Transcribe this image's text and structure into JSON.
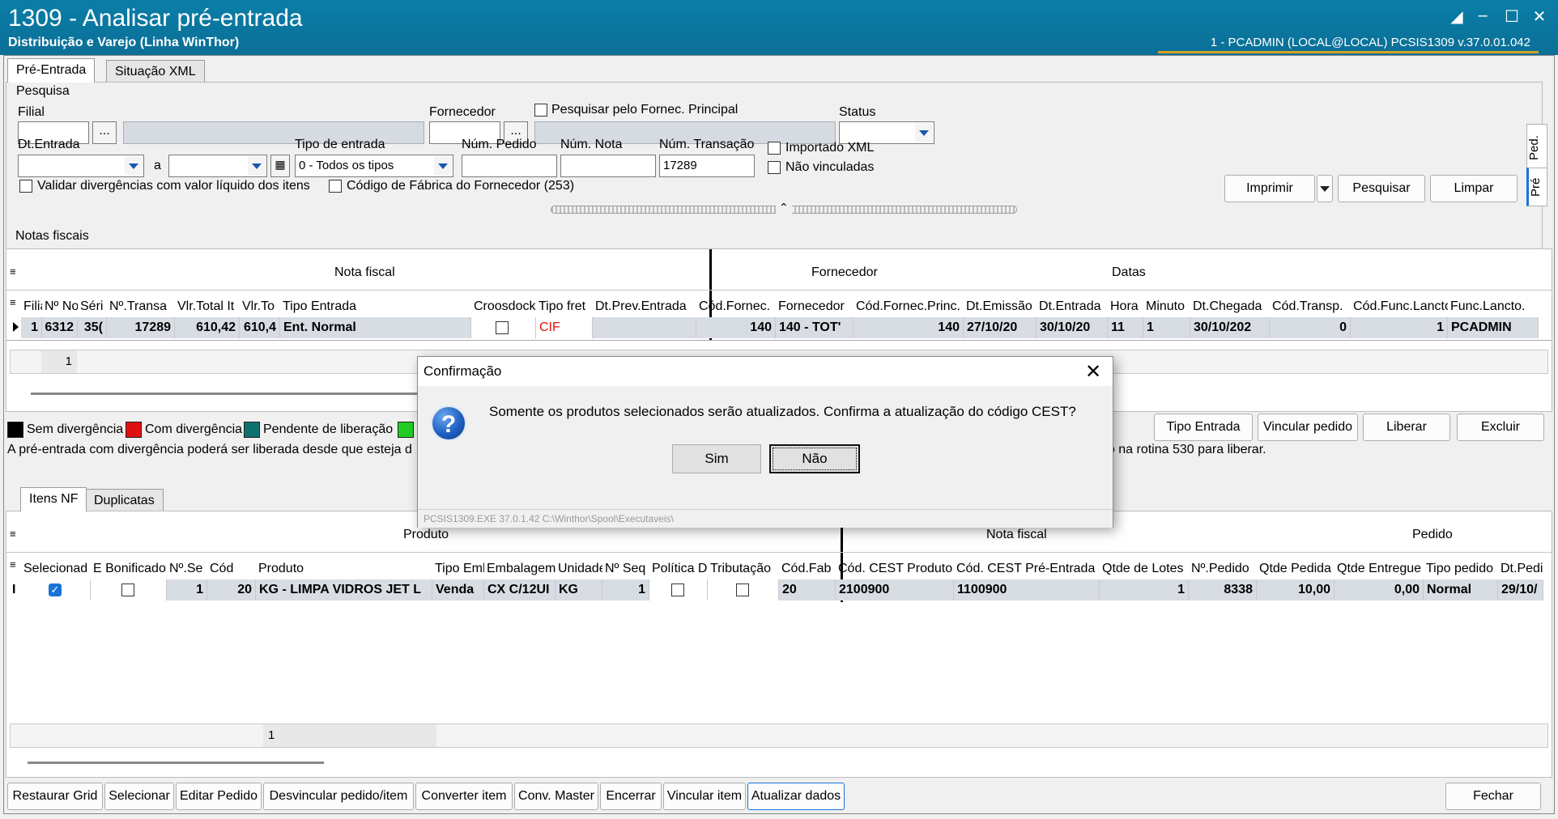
{
  "window": {
    "title": "1309 - Analisar pré-entrada",
    "subtitle": "Distribuição e Varejo (Linha WinThor)",
    "info": "1 - PCADMIN (LOCAL@LOCAL)   PCSIS1309  v.37.0.01.042"
  },
  "top_tabs": [
    "Pré-Entrada",
    "Situação XML"
  ],
  "search": {
    "group_label": "Pesquisa",
    "filial_label": "Filial",
    "fornecedor_label": "Fornecedor",
    "pesquisar_principal_label": "Pesquisar pelo Fornec. Principal",
    "status_label": "Status",
    "dt_entrada_label": "Dt.Entrada",
    "a_label": "a",
    "tipo_entrada_label": "Tipo de entrada",
    "tipo_entrada_value": "0 - Todos os tipos",
    "num_pedido_label": "Núm. Pedido",
    "num_nota_label": "Núm. Nota",
    "num_transacao_label": "Núm. Transação",
    "num_transacao_value": "17289",
    "importado_xml_label": "Importado XML",
    "nao_vinculadas_label": "Não vinculadas",
    "validar_label": "Validar divergências com valor líquido dos itens",
    "codigo_fabrica_label": "Código de Fábrica do Fornecedor (253)",
    "ellipsis": "...",
    "imprimir": "Imprimir",
    "pesquisar": "Pesquisar",
    "limpar": "Limpar"
  },
  "side_tabs": [
    "Ped.",
    "Pré"
  ],
  "notas": {
    "group_label": "Notas fiscais",
    "band_nota_fiscal": "Nota fiscal",
    "band_fornecedor": "Fornecedor",
    "band_datas": "Datas",
    "columns": [
      "Filia",
      "Nº No",
      "Séri",
      "Nº.Transa",
      "Vlr.Total It",
      "Vlr.To",
      "Tipo Entrada",
      "Croosdock",
      "Tipo fret",
      "Dt.Prev.Entrada",
      "Cód.Fornec.",
      "Fornecedor",
      "Cód.Fornec.Princ.",
      "Dt.Emissão",
      "Dt.Entrada",
      "Hora",
      "Minuto",
      "Dt.Chegada",
      "Cód.Transp.",
      "Cód.Func.Lancto",
      "Func.Lancto."
    ],
    "row": [
      "1",
      "6312",
      "35(",
      "17289",
      "610,42",
      "610,4",
      "Ent. Normal",
      "",
      "CIF",
      "",
      "140",
      "140 - TOT'",
      "140",
      "27/10/20",
      "30/10/20",
      "11",
      "1",
      "30/10/202",
      "0",
      "1",
      "PCADMIN"
    ],
    "footer_count": "1"
  },
  "legend": {
    "items": [
      {
        "label": "Sem divergência",
        "color": "#000000"
      },
      {
        "label": "Com divergência",
        "color": "#e01010"
      },
      {
        "label": "Pendente de liberação",
        "color": "#0f7070"
      },
      {
        "label": "",
        "color": "#22cc22"
      }
    ],
    "note_left": "A pré-entrada com divergência poderá ser liberada desde que esteja d",
    "note_right": "ão na rotina 530 para liberar."
  },
  "action_buttons": [
    "Tipo Entrada",
    "Vincular pedido",
    "Liberar",
    "Excluir"
  ],
  "item_tabs": [
    "Itens NF",
    "Duplicatas"
  ],
  "itens": {
    "band_produto": "Produto",
    "band_nota_fiscal": "Nota fiscal",
    "band_pedido": "Pedido",
    "columns": [
      "Selecionad",
      "E Bonificado",
      "Nº.Se",
      "Cód",
      "Produto",
      "Tipo Emb",
      "Embalagem",
      "Unidade",
      "Nº Seq",
      "Política D",
      "Tributação",
      "Cód.Fab",
      "Cód. CEST Produto",
      "Cód. CEST Pré-Entrada",
      "Qtde de Lotes",
      "Nº.Pedido",
      "Qtde Pedida",
      "Qtde Entregue",
      "Tipo pedido",
      "Dt.Pedi"
    ],
    "row": [
      "",
      "",
      "1",
      "20",
      "KG - LIMPA VIDROS JET L",
      "Venda",
      "CX C/12UI",
      "KG",
      "1",
      "",
      "",
      "20",
      "2100900",
      "1100900",
      "1",
      "8338",
      "10,00",
      "0,00",
      "Normal",
      "29/10/"
    ],
    "footer_count": "1"
  },
  "bottom_buttons": [
    "Restaurar Grid",
    "Selecionar",
    "Editar Pedido",
    "Desvincular pedido/item",
    "Converter item",
    "Conv. Master",
    "Encerrar",
    "Vincular item",
    "Atualizar dados"
  ],
  "fechar": "Fechar",
  "dialog": {
    "title": "Confirmação",
    "message": "Somente os produtos selecionados serão atualizados. Confirma a atualização do código CEST?",
    "yes": "Sim",
    "no": "Não",
    "footer": "PCSIS1309.EXE 37.0.1.42 C:\\Winthor\\Spool\\Executaveis\\"
  }
}
